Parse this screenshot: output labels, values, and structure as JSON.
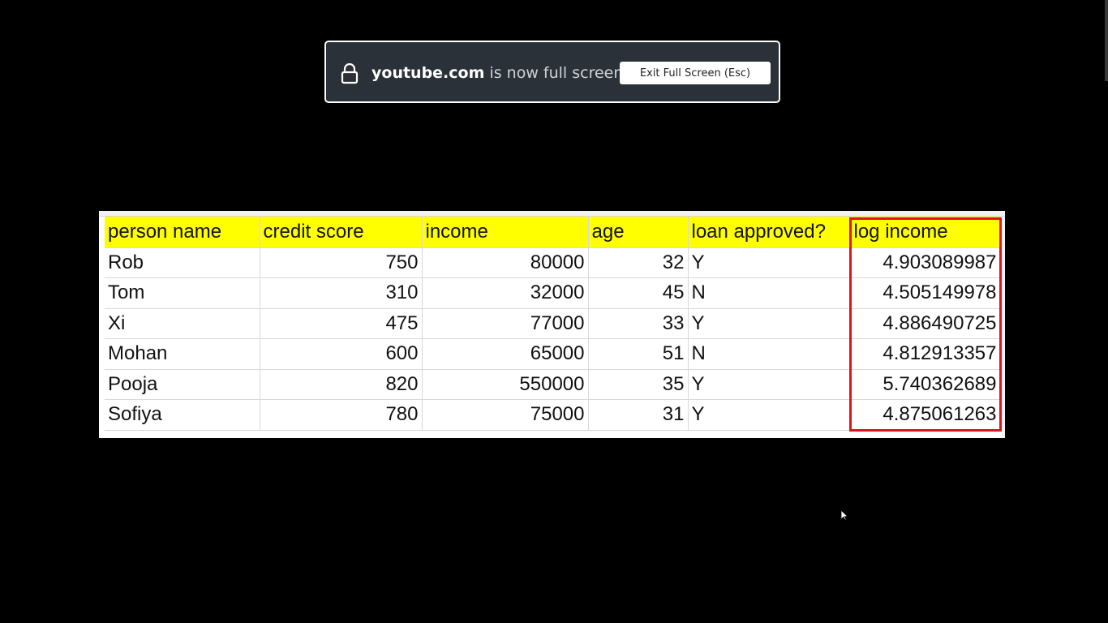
{
  "fullscreen_notice": {
    "domain": "youtube.com",
    "message": " is now full screen",
    "exit_label": "Exit Full Screen (Esc)"
  },
  "table": {
    "headers": [
      "person name",
      "credit score",
      "income",
      "age",
      "loan approved?",
      "log income"
    ],
    "rows": [
      [
        "Rob",
        "750",
        "80000",
        "32",
        "Y",
        "4.903089987"
      ],
      [
        "Tom",
        "310",
        "32000",
        "45",
        "N",
        "4.505149978"
      ],
      [
        "Xi",
        "475",
        "77000",
        "33",
        "Y",
        "4.886490725"
      ],
      [
        "Mohan",
        "600",
        "65000",
        "51",
        "N",
        "4.812913357"
      ],
      [
        "Pooja",
        "820",
        "550000",
        "35",
        "Y",
        "5.740362689"
      ],
      [
        "Sofiya",
        "780",
        "75000",
        "31",
        "Y",
        "4.875061263"
      ]
    ],
    "highlight_color": "#ffff00",
    "outline_color": "#e0141e"
  },
  "icons": {
    "lock": "lock-icon",
    "cursor": "mouse-pointer-icon"
  }
}
